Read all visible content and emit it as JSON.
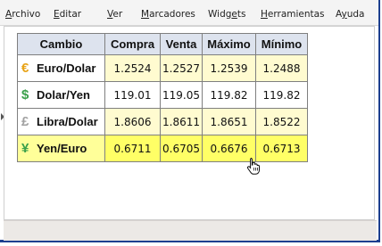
{
  "menu": {
    "items": [
      {
        "label_before": "",
        "mnemonic": "A",
        "label_after": "rchivo"
      },
      {
        "label_before": "",
        "mnemonic": "E",
        "label_after": "ditar"
      },
      {
        "label_before": "",
        "mnemonic": "V",
        "label_after": "er"
      },
      {
        "label_before": "",
        "mnemonic": "M",
        "label_after": "arcadores"
      },
      {
        "label_before": "Widg",
        "mnemonic": "e",
        "label_after": "ts"
      },
      {
        "label_before": "",
        "mnemonic": "H",
        "label_after": "erramientas"
      },
      {
        "label_before": "A",
        "mnemonic": "y",
        "label_after": "uda"
      }
    ]
  },
  "table": {
    "headers": [
      "Cambio",
      "Compra",
      "Venta",
      "Máximo",
      "Mínimo"
    ],
    "rows": [
      {
        "symbol": "€",
        "symbol_color": "#e8a317",
        "pair": "Euro/Dolar",
        "values": [
          "1.2524",
          "1.2527",
          "1.2539",
          "1.2488"
        ]
      },
      {
        "symbol": "$",
        "symbol_color": "#3aa04a",
        "pair": "Dolar/Yen",
        "values": [
          "119.01",
          "119.05",
          "119.82",
          "119.82"
        ]
      },
      {
        "symbol": "£",
        "symbol_color": "#a0a0a0",
        "pair": "Libra/Dolar",
        "values": [
          "1.8606",
          "1.8611",
          "1.8651",
          "1.8522"
        ]
      },
      {
        "symbol": "¥",
        "symbol_color": "#3aa04a",
        "pair": "Yen/Euro",
        "values": [
          "0.6711",
          "0.6705",
          "0.6676",
          "0.6713"
        ]
      }
    ]
  }
}
